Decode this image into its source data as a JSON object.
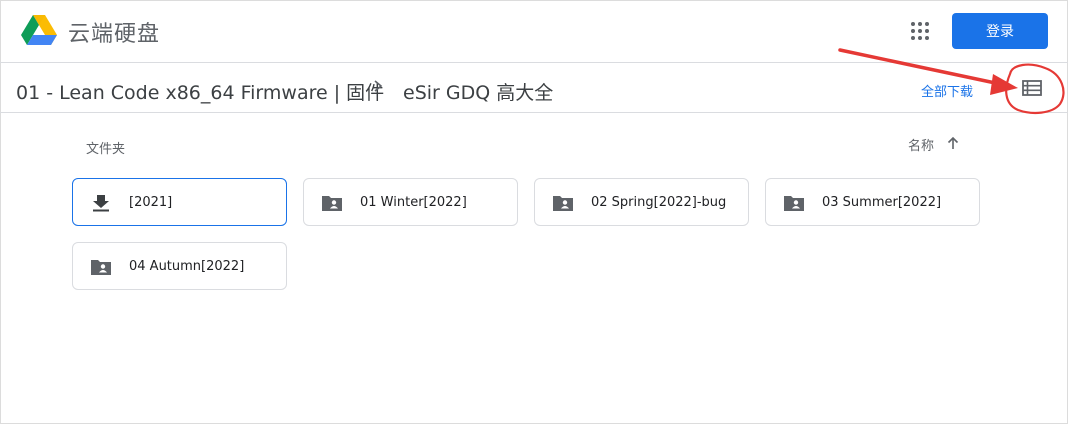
{
  "header": {
    "app_title": "云端硬盘",
    "login_label": "登录",
    "logo_icon": "google-drive-logo",
    "apps_icon": "apps-grid-icon"
  },
  "breadcrumb": {
    "parent": "01 - Lean Code x86_64 Firmware | 固件",
    "current": "eSir GDQ 高大全",
    "separator_icon": "chevron-right-icon"
  },
  "toolbar": {
    "download_all": "全部下载",
    "view_toggle_icon": "list-view-icon"
  },
  "section": {
    "label": "文件夹",
    "sort_label": "名称",
    "sort_icon": "arrow-up-icon"
  },
  "folders": [
    {
      "name": "[2021]",
      "icon": "download-icon",
      "selected": true
    },
    {
      "name": "01 Winter[2022]",
      "icon": "shared-folder-icon",
      "selected": false
    },
    {
      "name": "02 Spring[2022]-bug",
      "icon": "shared-folder-icon",
      "selected": false
    },
    {
      "name": "03 Summer[2022]",
      "icon": "shared-folder-icon",
      "selected": false
    },
    {
      "name": "04 Autumn[2022]",
      "icon": "shared-folder-icon",
      "selected": false
    }
  ],
  "colors": {
    "accent": "#1a73e8",
    "annotation": "#e53935",
    "text": "#202124",
    "muted": "#5f6368",
    "border": "#dadce0"
  }
}
